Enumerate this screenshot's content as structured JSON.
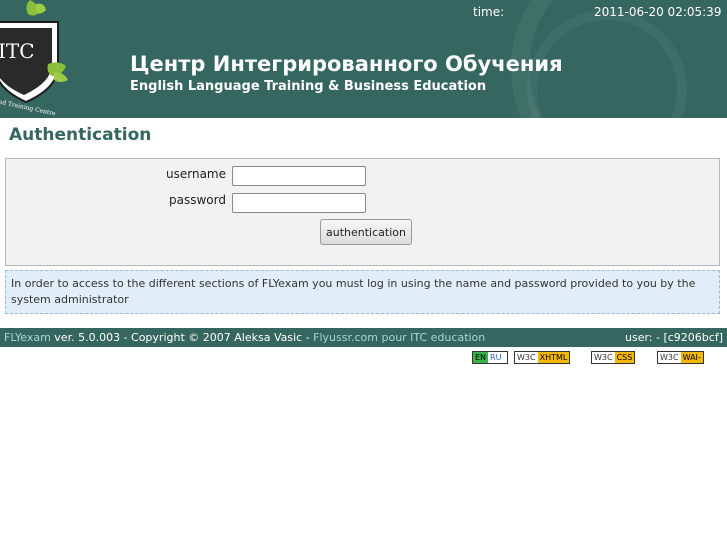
{
  "header": {
    "time_label": "time:",
    "time_value": "2011-06-20 02:05:39",
    "title_ru": "Центр Интегрированного Обучения",
    "title_en": "English Language Training & Business Education",
    "logo_text": "ITC",
    "logo_ring_text": "ed Training Centre"
  },
  "page": {
    "title": "Authentication"
  },
  "form": {
    "username_label": "username",
    "password_label": "password",
    "username_value": "",
    "password_value": "",
    "submit_label": "authentication"
  },
  "info": {
    "text": "In order to access to the different sections of FLYexam you must log in using the name and password provided to you by the system administrator"
  },
  "footer": {
    "app_name": "FLYexam",
    "version_text": " ver. 5.0.003 - Copyright © 2007 Aleksa Vasic - ",
    "link_text": "Flyussr.com pour ITC education",
    "user_text": "user: - [c9206bcf]"
  },
  "badges": {
    "lang_en": "EN",
    "lang_ru": "RU",
    "w3c": "W3C",
    "xhtml": "XHTML 1.0",
    "css": "CSS 2.0",
    "wai": "WAI-AAA"
  },
  "colors": {
    "header_bg": "#35665f",
    "title_color": "#35665f",
    "info_bg": "#e1edf8",
    "badge_accent": "#f5b800"
  }
}
